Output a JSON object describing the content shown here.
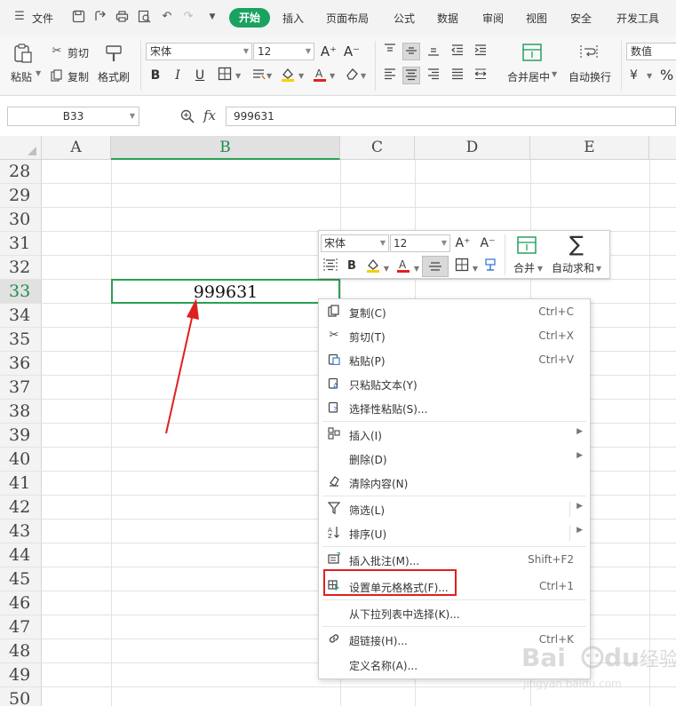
{
  "menubar": {
    "file_label": "文件",
    "tabs": [
      "开始",
      "插入",
      "页面布局",
      "公式",
      "数据",
      "审阅",
      "视图",
      "安全",
      "开发工具"
    ],
    "active_tab": "开始"
  },
  "ribbon": {
    "paste": "粘贴",
    "cut": "剪切",
    "copy": "复制",
    "format_painter": "格式刷",
    "font_name": "宋体",
    "font_size": "12",
    "merge_center": "合并居中",
    "wrap_text": "自动换行",
    "number_format": "数值"
  },
  "formula_bar": {
    "name_box": "B33",
    "fx_label": "fx",
    "content": "999631"
  },
  "grid": {
    "columns": [
      "A",
      "B",
      "C",
      "D",
      "E"
    ],
    "selected_column": "B",
    "rows": [
      "28",
      "29",
      "30",
      "31",
      "32",
      "33",
      "34",
      "35",
      "36",
      "37",
      "38",
      "39",
      "40",
      "41",
      "42",
      "43",
      "44",
      "45",
      "46",
      "47",
      "48",
      "49",
      "50"
    ],
    "selected_row": "33",
    "active_cell_value": "999631"
  },
  "mini_toolbar": {
    "font_name": "宋体",
    "font_size": "12",
    "merge_label": "合并",
    "autosum_label": "自动求和"
  },
  "context_menu": {
    "items": [
      {
        "label": "复制(C)",
        "shortcut": "Ctrl+C",
        "icon": "copy-icon"
      },
      {
        "label": "剪切(T)",
        "shortcut": "Ctrl+X",
        "icon": "scissors-icon"
      },
      {
        "label": "粘贴(P)",
        "shortcut": "Ctrl+V",
        "icon": "paste-icon"
      },
      {
        "label": "只粘贴文本(Y)",
        "shortcut": "",
        "icon": "paste-text-icon"
      },
      {
        "label": "选择性粘贴(S)...",
        "shortcut": "",
        "icon": "paste-special-icon"
      },
      {
        "label": "插入(I)",
        "shortcut": "",
        "icon": "insert-icon"
      },
      {
        "label": "删除(D)",
        "shortcut": "",
        "icon": ""
      },
      {
        "label": "清除内容(N)",
        "shortcut": "",
        "icon": "eraser-icon"
      },
      {
        "label": "筛选(L)",
        "shortcut": "",
        "icon": "filter-icon"
      },
      {
        "label": "排序(U)",
        "shortcut": "",
        "icon": "sort-icon"
      },
      {
        "label": "插入批注(M)...",
        "shortcut": "Shift+F2",
        "icon": "comment-icon"
      },
      {
        "label": "设置单元格格式(F)...",
        "shortcut": "Ctrl+1",
        "icon": "format-cells-icon"
      },
      {
        "label": "从下拉列表中选择(K)...",
        "shortcut": "",
        "icon": ""
      },
      {
        "label": "超链接(H)...",
        "shortcut": "Ctrl+K",
        "icon": "link-icon"
      },
      {
        "label": "定义名称(A)...",
        "shortcut": "",
        "icon": ""
      }
    ]
  },
  "colors": {
    "accent_green": "#1aa261",
    "selection_green": "#2b9f52",
    "annotation_red": "#e02020"
  }
}
